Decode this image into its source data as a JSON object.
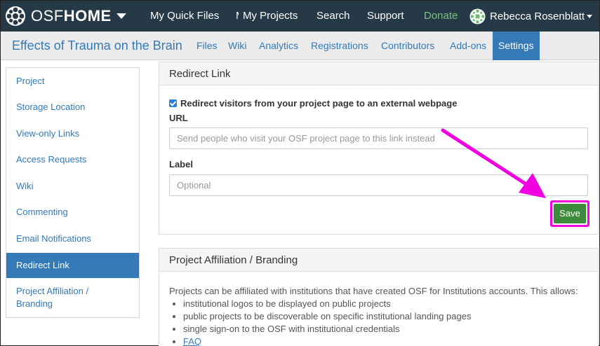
{
  "topnav": {
    "brand_osf": "OSF",
    "brand_home": "HOME",
    "items": [
      "My Quick Files",
      "M",
      "My Projects",
      "Search",
      "Support",
      "Donate"
    ],
    "user_name": "Rebecca Rosenblatt"
  },
  "project": {
    "title": "Effects of Trauma on the Brain",
    "tabs": [
      "Files",
      "Wiki",
      "Analytics",
      "Registrations",
      "Contributors",
      "Add-ons",
      "Settings"
    ]
  },
  "sidebar": {
    "items": [
      "Project",
      "Storage Location",
      "View-only Links",
      "Access Requests",
      "Wiki",
      "Commenting",
      "Email Notifications",
      "Redirect Link",
      "Project Affiliation /",
      "Branding"
    ]
  },
  "redirect": {
    "heading": "Redirect Link",
    "checkbox_label": "Redirect visitors from your project page to an external webpage",
    "url_label": "URL",
    "url_placeholder": "Send people who visit your OSF project page to this link instead",
    "label_label": "Label",
    "label_placeholder": "Optional",
    "save_label": "Save"
  },
  "affiliation": {
    "heading": "Project Affiliation / Branding",
    "intro": "Projects can be affiliated with institutions that have created OSF for Institutions accounts. This allows:",
    "bullets": [
      "institutional logos to be displayed on public projects",
      "public projects to be discoverable on specific institutional landing pages",
      "single sign-on to the OSF with institutional credentials"
    ],
    "faq": "FAQ"
  },
  "colors": {
    "navbar": "#263947",
    "link_blue": "#337ab7",
    "donate_green": "#7bc47b",
    "save_green": "#3c8a3c",
    "annotation_magenta": "#f000e0"
  },
  "icons": {
    "brand": "osf-logo-icon",
    "user": "user-avatar-icon",
    "checkbox": "checkbox-checked-icon",
    "annotation": "arrow-annotation-icon"
  }
}
